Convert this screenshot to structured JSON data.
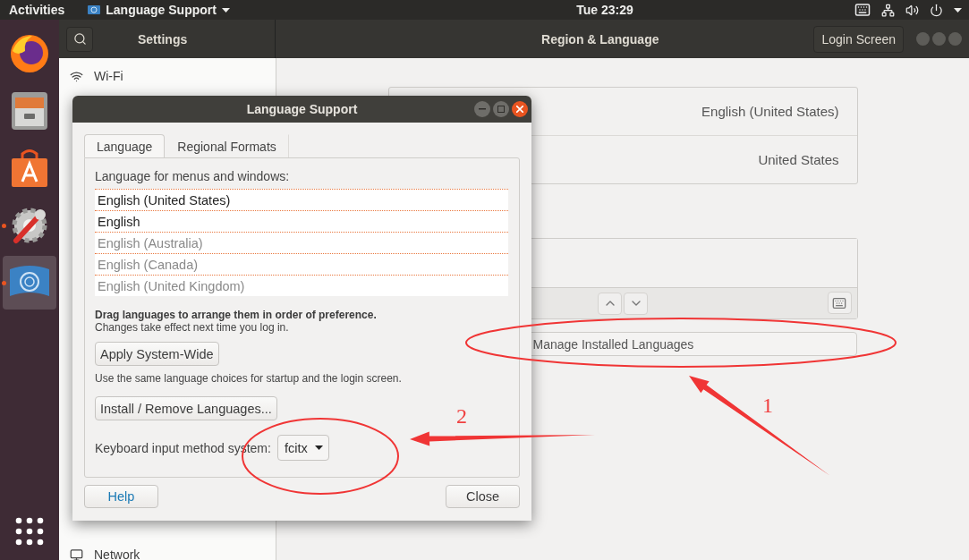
{
  "top_bar": {
    "activities": "Activities",
    "app_menu": "Language Support",
    "clock": "Tue 23:29"
  },
  "dock": {
    "items": [
      {
        "kind": "firefox",
        "running": false,
        "selected": false
      },
      {
        "kind": "files",
        "running": false,
        "selected": false
      },
      {
        "kind": "software",
        "running": false,
        "selected": false
      },
      {
        "kind": "tools",
        "running": true,
        "selected": false
      },
      {
        "kind": "language",
        "running": true,
        "selected": true
      }
    ]
  },
  "settings_window": {
    "title": "Settings",
    "page_title": "Region & Language",
    "login_button": "Login Screen",
    "sidebar": [
      {
        "kind": "wifi",
        "label": "Wi-Fi"
      },
      {
        "kind": "network",
        "label": "Network"
      }
    ],
    "format_rows": [
      {
        "value": "English (United States)"
      },
      {
        "value": "United States"
      }
    ],
    "manage_button": "Manage Installed Languages"
  },
  "dialog": {
    "title": "Language Support",
    "tabs": [
      {
        "label": "Language",
        "selected": true
      },
      {
        "label": "Regional Formats",
        "selected": false
      }
    ],
    "list_label": "Language for menus and windows:",
    "languages": [
      {
        "label": "English (United States)",
        "disabled": false
      },
      {
        "label": "English",
        "disabled": false
      },
      {
        "label": "English (Australia)",
        "disabled": true
      },
      {
        "label": "English (Canada)",
        "disabled": true
      },
      {
        "label": "English (United Kingdom)",
        "disabled": true
      }
    ],
    "drag_hint": "Drag languages to arrange them in order of preference.",
    "effect_note": "Changes take effect next time you log in.",
    "apply_button": "Apply System-Wide",
    "apply_note": "Use the same language choices for startup and the login screen.",
    "install_button": "Install / Remove Languages...",
    "input_method_label": "Keyboard input method system:",
    "input_method": "fcitx",
    "help_button": "Help",
    "close_button": "Close"
  },
  "annotations": [
    {
      "label": "1"
    },
    {
      "label": "2"
    }
  ]
}
